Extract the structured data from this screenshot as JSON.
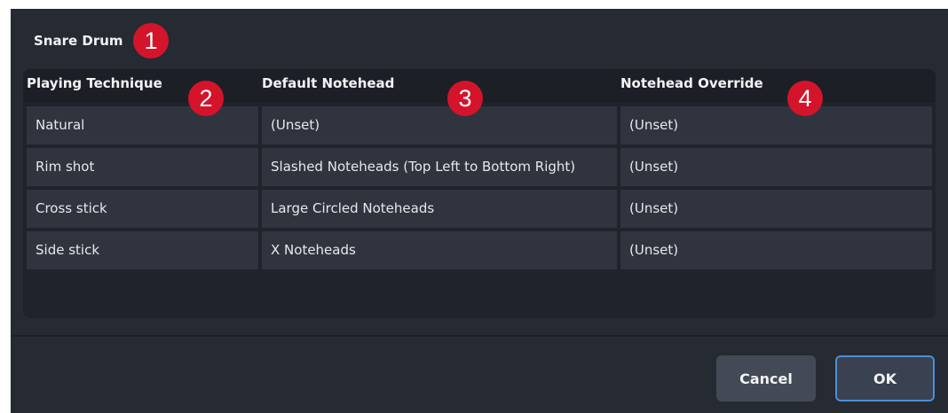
{
  "dialog": {
    "title": "Snare Drum",
    "columns": [
      "Playing Technique",
      "Default Notehead",
      "Notehead Override"
    ],
    "rows": [
      [
        "Natural",
        "(Unset)",
        "(Unset)"
      ],
      [
        "Rim shot",
        "Slashed Noteheads (Top Left to Bottom Right)",
        "(Unset)"
      ],
      [
        "Cross stick",
        "Large Circled Noteheads",
        "(Unset)"
      ],
      [
        "Side stick",
        "X Noteheads",
        "(Unset)"
      ]
    ],
    "buttons": {
      "cancel": "Cancel",
      "ok": "OK"
    }
  },
  "callouts": [
    "1",
    "2",
    "3",
    "4"
  ],
  "colors": {
    "dialog_bg": "#262a33",
    "cell_bg": "#30343e",
    "callout_red": "#d4142a",
    "ok_border": "#4a8fd6"
  }
}
